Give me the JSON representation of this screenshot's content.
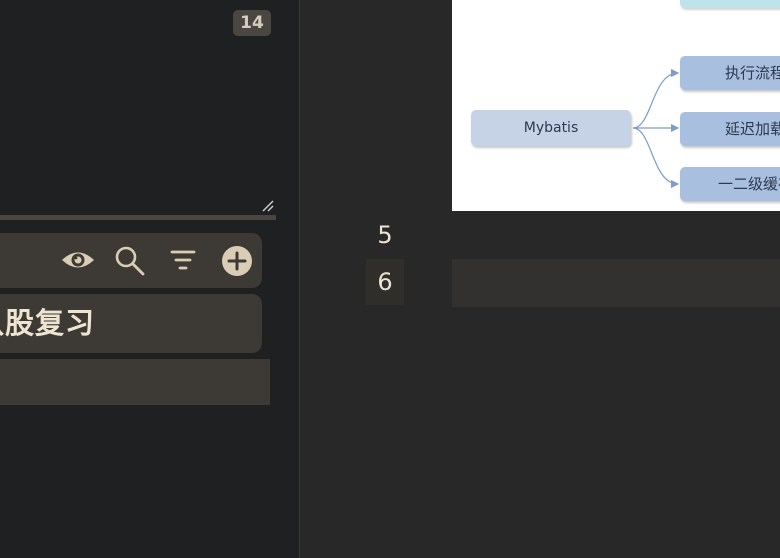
{
  "sidebar": {
    "count_badge": "14",
    "toolbar": {
      "icons": [
        "eye-icon",
        "search-icon",
        "filter-icon",
        "add-icon"
      ]
    },
    "note_title": "八股复习"
  },
  "editor": {
    "line_numbers": [
      "5",
      "6"
    ],
    "diagram": {
      "root": "Mybatis",
      "children": [
        "执行流程",
        "延迟加载",
        "一二级缓存"
      ]
    }
  },
  "colors": {
    "panel_bg": "#1f2022",
    "editor_bg": "#282828",
    "card_bg": "#3d3a35",
    "accent_text": "#eee4d2",
    "diagram_root": "#c6d3e7",
    "diagram_child": "#a8bfe0",
    "connector": "#7d9cc8"
  }
}
